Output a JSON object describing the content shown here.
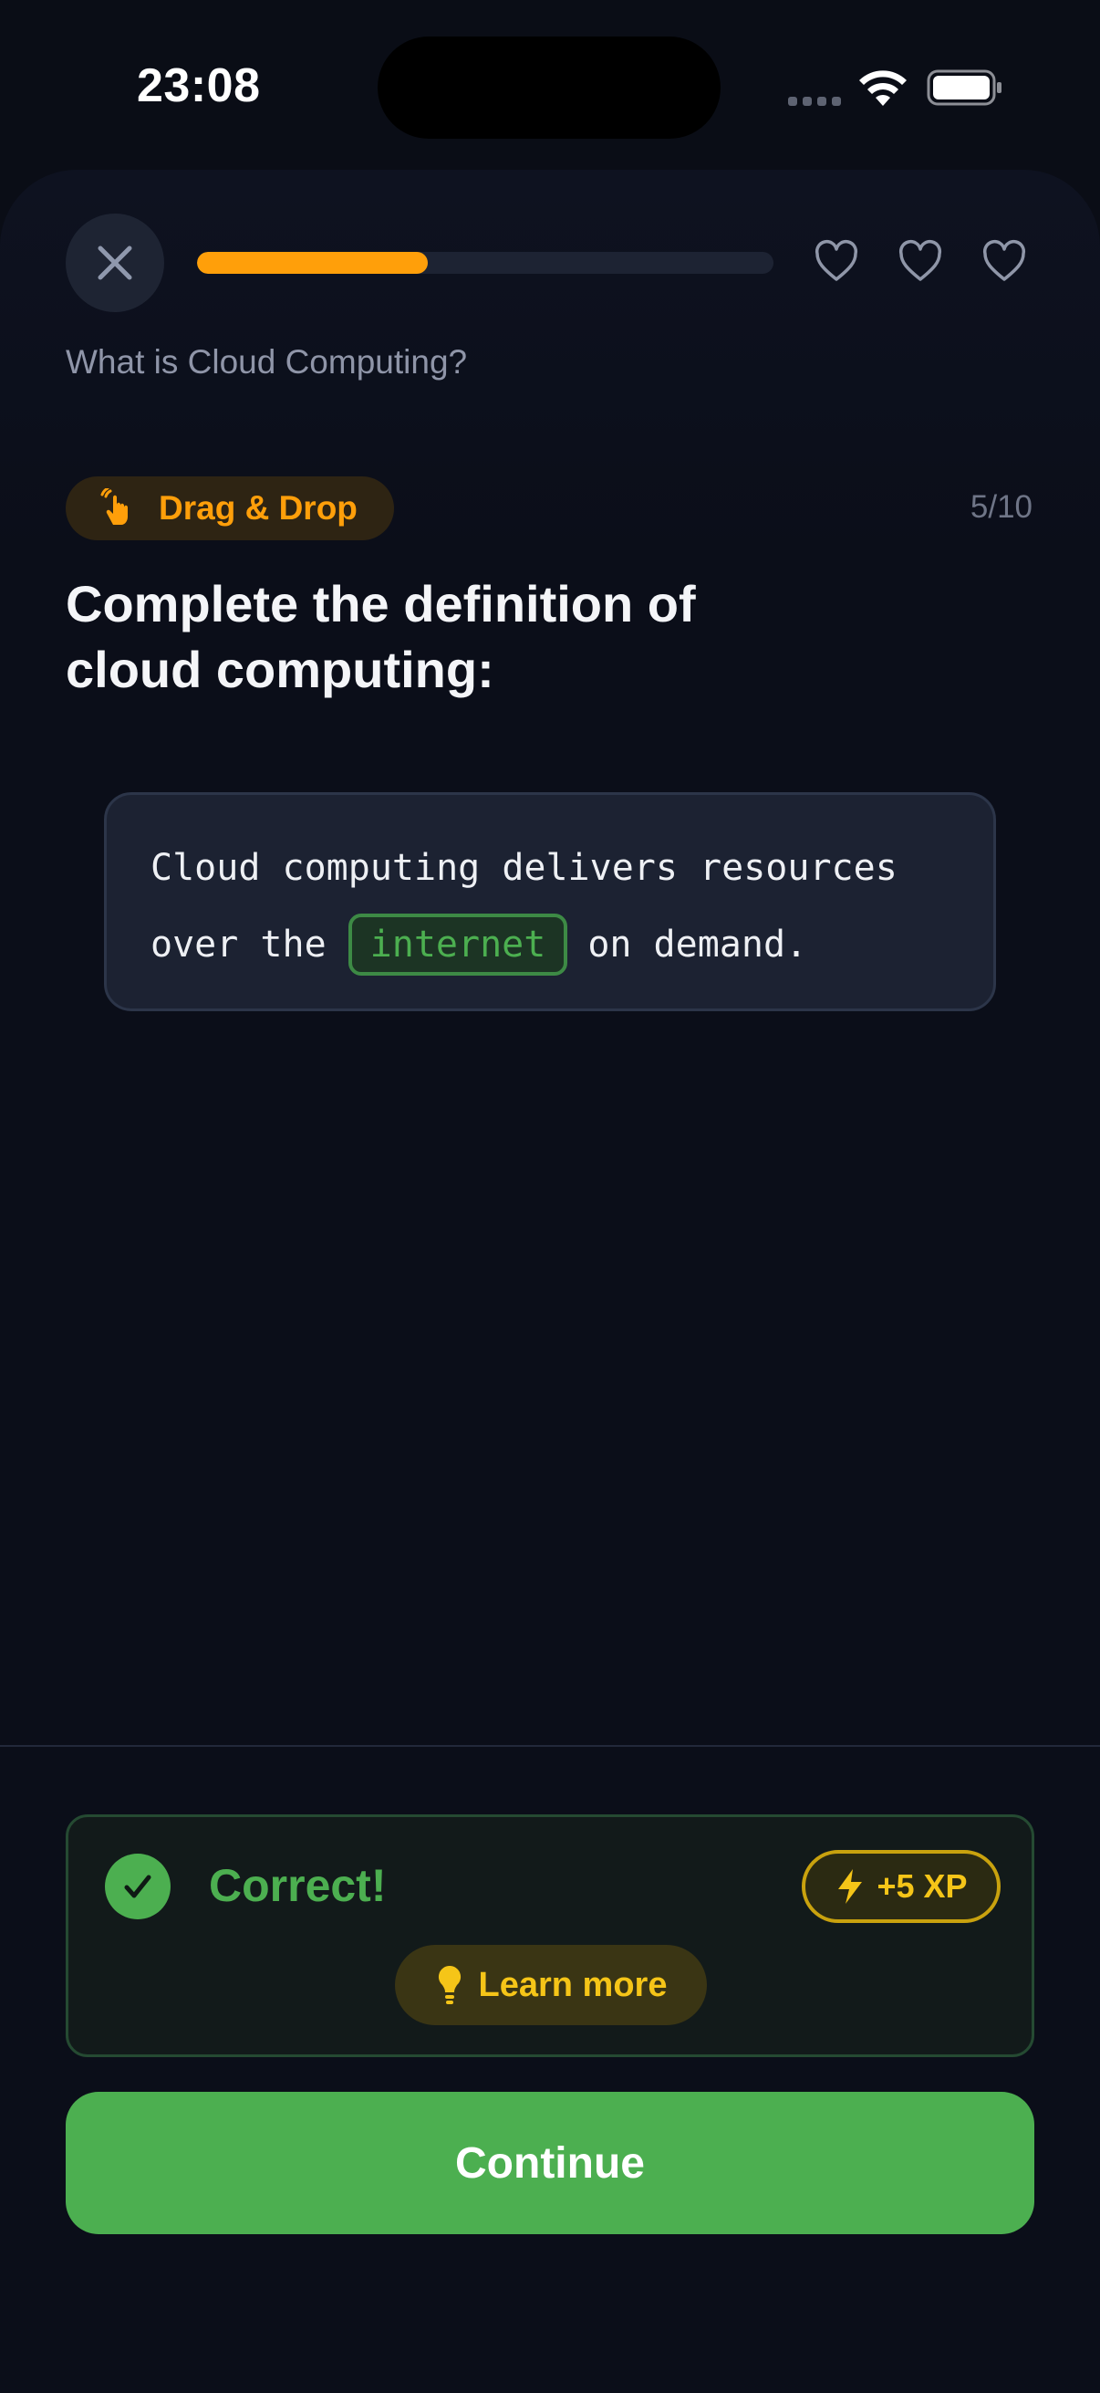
{
  "status_bar": {
    "time": "23:08"
  },
  "header": {
    "progress": 0.4,
    "hearts_count": 3,
    "lesson_title": "What is Cloud Computing?"
  },
  "question": {
    "type_label": "Drag & Drop",
    "counter": "5/10",
    "prompt": "Complete the definition of cloud computing:",
    "line1": "Cloud computing delivers resources",
    "line2_before": "over the",
    "answer": "internet",
    "line2_after": "on demand."
  },
  "feedback": {
    "result": "Correct!",
    "xp": "+5 XP",
    "learn_more": "Learn more"
  },
  "actions": {
    "continue": "Continue"
  },
  "colors": {
    "accent_orange": "#ff9f0a",
    "success_green": "#4caf50",
    "xp_yellow": "#f5c518",
    "background": "#0a0d16"
  }
}
